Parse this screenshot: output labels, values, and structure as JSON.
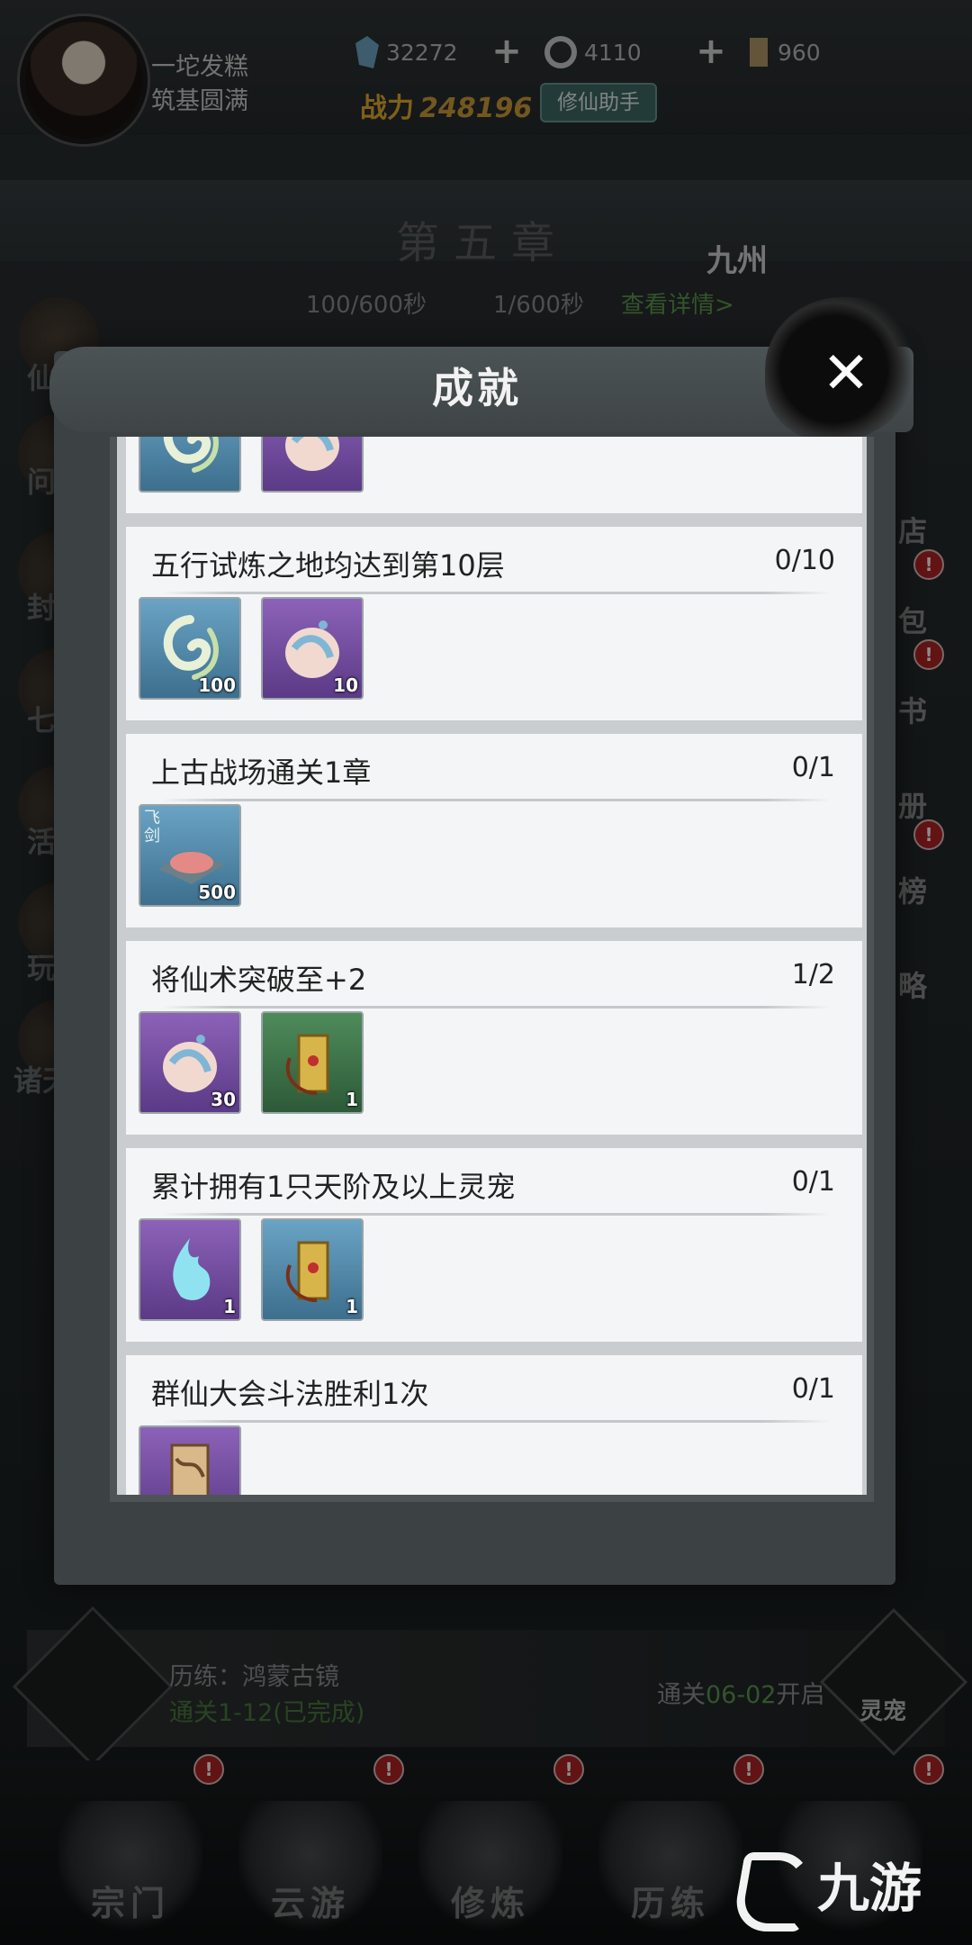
{
  "player": {
    "name": "一坨发糕",
    "rank": "筑基圆满"
  },
  "resources": [
    {
      "icon": "spirit-stone-icon",
      "value": "32272"
    },
    {
      "icon": "spirit-coin-icon",
      "value": "4110"
    },
    {
      "icon": "scroll-icon",
      "value": "960"
    }
  ],
  "power": {
    "label": "战力",
    "value": "248196"
  },
  "assist_label": "修仙助手",
  "background": {
    "chapter": "第五章",
    "region": "九州",
    "income_stone": "100/600秒",
    "income_scroll": "1/600秒",
    "details_link": "查看详情>",
    "left_labels": [
      "仙",
      "问",
      "封",
      "七",
      "活",
      "玩",
      "诸天"
    ],
    "right_labels": [
      "店",
      "包",
      "书",
      "册",
      "榜",
      "略"
    ]
  },
  "modal": {
    "title": "成就",
    "achievements": [
      {
        "title": "",
        "progress": "",
        "rewards": [
          {
            "icon": "wind-orb-icon",
            "qty": "",
            "color": "blue"
          },
          {
            "icon": "spirit-orb-icon",
            "qty": "",
            "color": "purple"
          }
        ]
      },
      {
        "title": "五行试炼之地均达到第10层",
        "progress": "0/10",
        "rewards": [
          {
            "icon": "wind-orb-icon",
            "qty": "100",
            "color": "blue"
          },
          {
            "icon": "spirit-orb-icon",
            "qty": "10",
            "color": "purple"
          }
        ]
      },
      {
        "title": "上古战场通关1章",
        "progress": "0/1",
        "rewards": [
          {
            "icon": "flying-sword-dust-icon",
            "qty": "500",
            "color": "blue",
            "tag": "飞剑"
          }
        ]
      },
      {
        "title": "将仙术突破至+2",
        "progress": "1/2",
        "rewards": [
          {
            "icon": "spirit-orb-icon",
            "qty": "30",
            "color": "purple"
          },
          {
            "icon": "talisman-icon",
            "qty": "1",
            "color": "green"
          }
        ]
      },
      {
        "title": "累计拥有1只天阶及以上灵宠",
        "progress": "0/1",
        "rewards": [
          {
            "icon": "spirit-flame-icon",
            "qty": "1",
            "color": "purple"
          },
          {
            "icon": "talisman-icon",
            "qty": "1",
            "color": "blue"
          }
        ]
      },
      {
        "title": "群仙大会斗法胜利1次",
        "progress": "0/1",
        "rewards": [
          {
            "icon": "scroll-item-icon",
            "qty": "",
            "color": "purple"
          }
        ]
      }
    ]
  },
  "trial": {
    "title": "历练：鸿蒙古镜",
    "subtitle": "通关1-12(已完成)",
    "unlock_prefix": "通关",
    "unlock_stage": "06-02",
    "unlock_suffix": "开启"
  },
  "pet_label": "灵宠",
  "nav": [
    {
      "label": "宗门"
    },
    {
      "label": "云游"
    },
    {
      "label": "修炼"
    },
    {
      "label": "历练"
    },
    {
      "label": ""
    }
  ],
  "alert_mark": "!",
  "watermark": "九游"
}
